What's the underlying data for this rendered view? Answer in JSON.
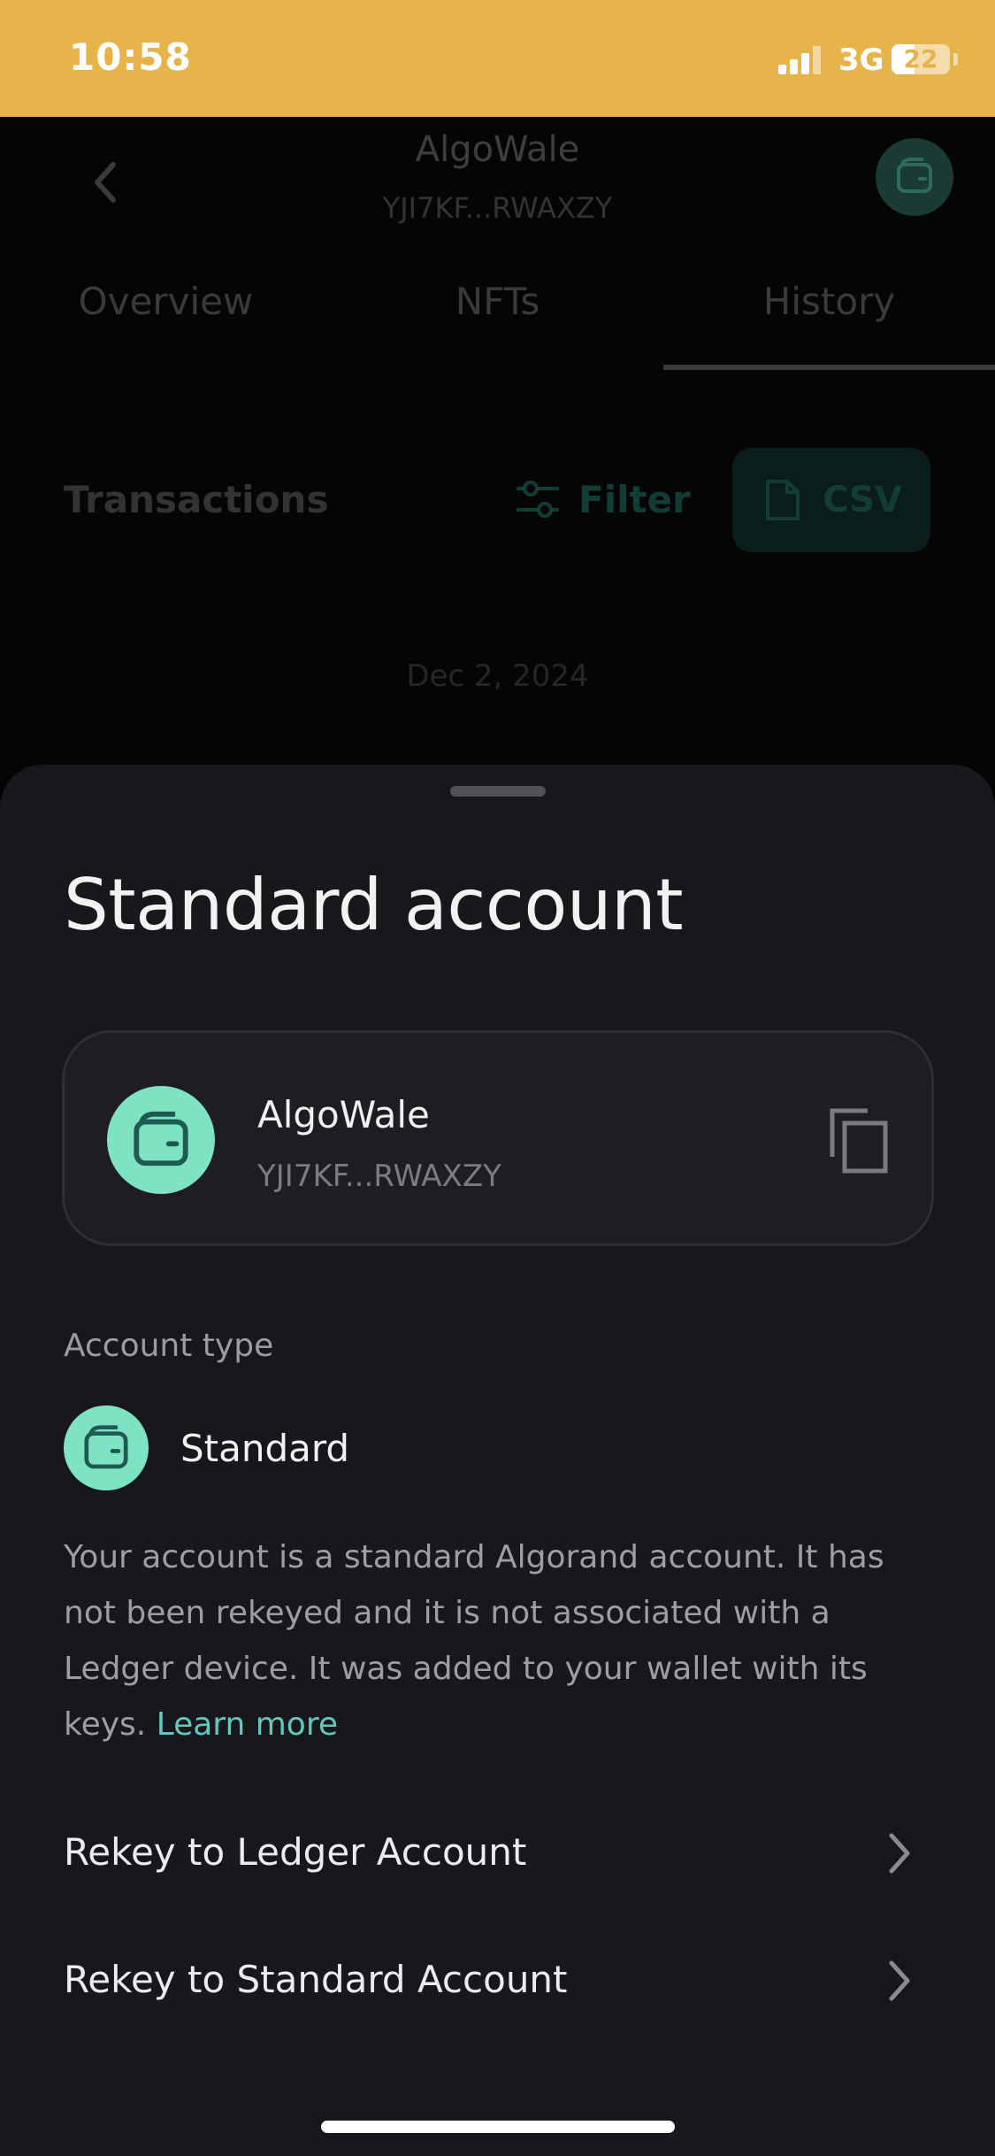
{
  "status_bar": {
    "time": "10:58",
    "network": "3G",
    "battery": "22",
    "background_color": "#e6b44a"
  },
  "header": {
    "title": "AlgoWale",
    "address": "YJI7KF...RWAXZY"
  },
  "tabs": [
    {
      "label": "Overview",
      "active": false
    },
    {
      "label": "NFTs",
      "active": false
    },
    {
      "label": "History",
      "active": true
    }
  ],
  "transactions": {
    "title": "Transactions",
    "filter_label": "Filter",
    "csv_label": "CSV",
    "date": "Dec 2, 2024"
  },
  "sheet": {
    "title": "Standard account",
    "account": {
      "name": "AlgoWale",
      "address": "YJI7KF...RWAXZY"
    },
    "account_type_label": "Account type",
    "account_type": "Standard",
    "description": "Your account is a standard Algorand account. It has not been rekeyed and it is not associated with a Ledger device. It was added to your wallet with its keys.",
    "learn_more": "Learn more",
    "actions": [
      {
        "label": "Rekey to Ledger Account"
      },
      {
        "label": "Rekey to Standard Account"
      }
    ]
  },
  "colors": {
    "accent": "#7ee3c3",
    "link": "#63c7bd",
    "sheet_bg": "#18181c"
  },
  "icons": [
    "back-arrow-icon",
    "wallet-icon",
    "filter-sliders-icon",
    "csv-file-icon",
    "copy-icon",
    "chevron-right-icon"
  ]
}
